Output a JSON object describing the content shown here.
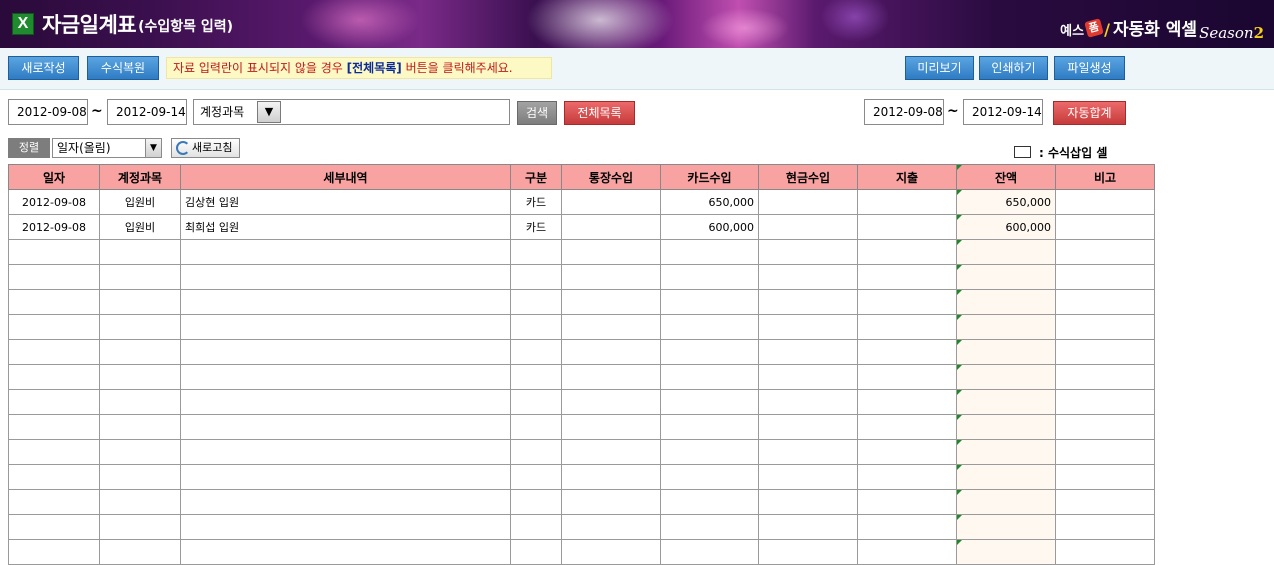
{
  "header": {
    "icon": "excel-x-icon",
    "title": "자금일계표",
    "subtitle": "(수입항목 입력)",
    "brand": {
      "prefix": "예스",
      "badge": "폼",
      "name": "자동화 엑셀",
      "season": "Season",
      "season_num": "2"
    }
  },
  "toolbar": {
    "new_label": "새로작성",
    "restore_label": "수식복원",
    "notice_before": "자료 입력란이 표시되지  않을 경우 ",
    "notice_highlight": "[전체목록]",
    "notice_after": " 버튼을 클릭해주세요.",
    "preview_label": "미리보기",
    "print_label": "인쇄하기",
    "file_label": "파일생성"
  },
  "filter": {
    "date_from": "2012-09-08",
    "date_to": "2012-09-14",
    "tilde": "~",
    "account_label": "계정과목",
    "search_value": "",
    "search_label": "검색",
    "all_list_label": "전체목록",
    "sum_date_from": "2012-09-08",
    "sum_date_to": "2012-09-14",
    "auto_sum_label": "자동합계"
  },
  "sort": {
    "label": "정렬",
    "selected": "일자(올림)",
    "refresh_label": "새로고침"
  },
  "legend": {
    "label": ": 수식삽입 셀"
  },
  "table": {
    "columns": [
      "일자",
      "계정과목",
      "세부내역",
      "구분",
      "통장수입",
      "카드수입",
      "현금수입",
      "지출",
      "잔액",
      "비고"
    ],
    "rows": [
      [
        "2012-09-08",
        "입원비",
        "김상현 입원",
        "카드",
        "",
        "650,000",
        "",
        "",
        "650,000",
        ""
      ],
      [
        "2012-09-08",
        "입원비",
        "최희섭 입원",
        "카드",
        "",
        "600,000",
        "",
        "",
        "600,000",
        ""
      ],
      [
        "",
        "",
        "",
        "",
        "",
        "",
        "",
        "",
        "",
        ""
      ],
      [
        "",
        "",
        "",
        "",
        "",
        "",
        "",
        "",
        "",
        ""
      ],
      [
        "",
        "",
        "",
        "",
        "",
        "",
        "",
        "",
        "",
        ""
      ],
      [
        "",
        "",
        "",
        "",
        "",
        "",
        "",
        "",
        "",
        ""
      ],
      [
        "",
        "",
        "",
        "",
        "",
        "",
        "",
        "",
        "",
        ""
      ],
      [
        "",
        "",
        "",
        "",
        "",
        "",
        "",
        "",
        "",
        ""
      ],
      [
        "",
        "",
        "",
        "",
        "",
        "",
        "",
        "",
        "",
        ""
      ],
      [
        "",
        "",
        "",
        "",
        "",
        "",
        "",
        "",
        "",
        ""
      ],
      [
        "",
        "",
        "",
        "",
        "",
        "",
        "",
        "",
        "",
        ""
      ],
      [
        "",
        "",
        "",
        "",
        "",
        "",
        "",
        "",
        "",
        ""
      ],
      [
        "",
        "",
        "",
        "",
        "",
        "",
        "",
        "",
        "",
        ""
      ],
      [
        "",
        "",
        "",
        "",
        "",
        "",
        "",
        "",
        "",
        ""
      ],
      [
        "",
        "",
        "",
        "",
        "",
        "",
        "",
        "",
        "",
        ""
      ]
    ]
  }
}
